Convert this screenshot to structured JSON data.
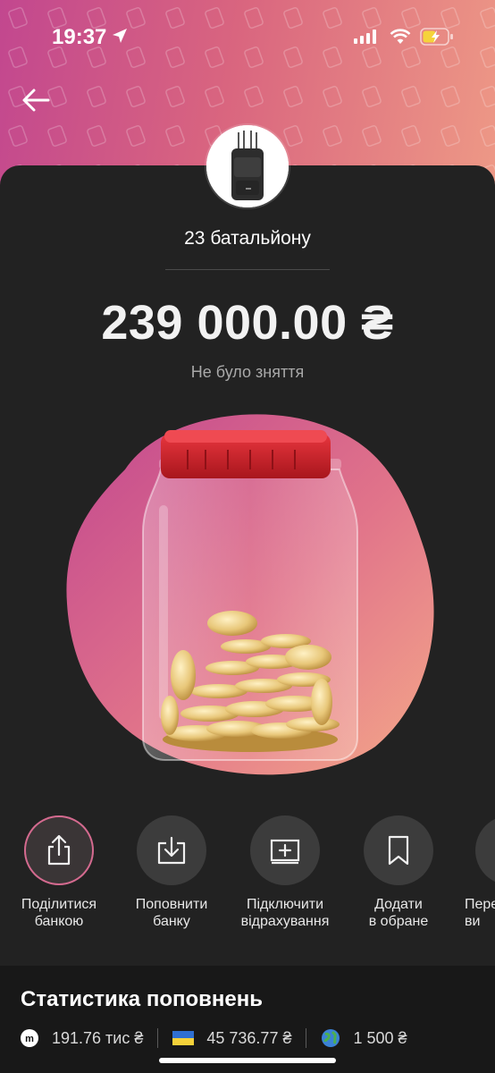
{
  "status_bar": {
    "time": "19:37"
  },
  "jar": {
    "name": "23 батальйону",
    "amount": "239 000.00 ₴",
    "withdraw_status": "Не було зняття"
  },
  "actions": [
    {
      "label": "Поділитися\nбанкою",
      "icon": "share-icon"
    },
    {
      "label": "Поповнити\nбанку",
      "icon": "top-up-icon"
    },
    {
      "label": "Підключити\nвідрахування",
      "icon": "add-deduction-icon"
    },
    {
      "label": "Додати\nв обране",
      "icon": "bookmark-icon"
    },
    {
      "label": "Пере\nви",
      "icon": "more-icon"
    }
  ],
  "stats": {
    "title": "Статистика поповнень",
    "items": [
      {
        "value": "191.76 тис ₴",
        "icon": "monobank-icon"
      },
      {
        "value": "45 736.77 ₴",
        "icon": "ukraine-flag-icon"
      },
      {
        "value": "1 500 ₴",
        "icon": "globe-icon"
      }
    ]
  },
  "colors": {
    "header_gradient": [
      "#c2478f",
      "#ee9a86"
    ],
    "background": "#222222",
    "jar_lid": "#d0242c"
  }
}
